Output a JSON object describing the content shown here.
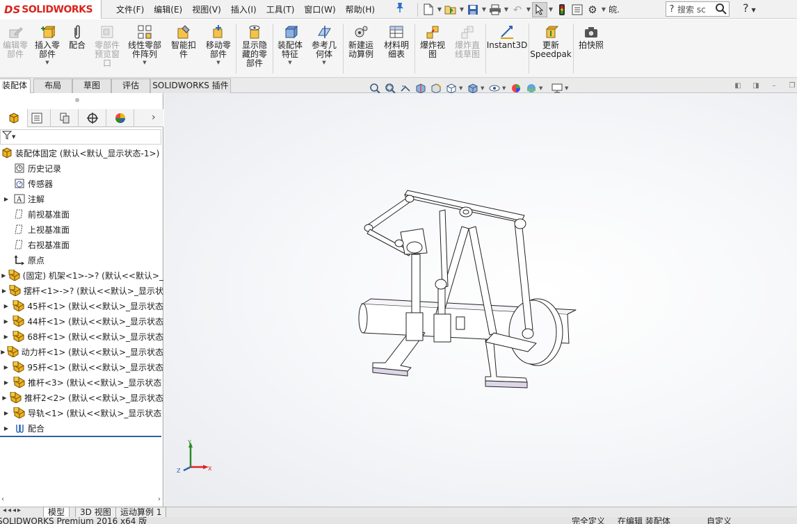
{
  "app": {
    "brand_ds": "DS",
    "brand": "SOLIDWORKS"
  },
  "menu": [
    "文件(F)",
    "编辑(E)",
    "视图(V)",
    "插入(I)",
    "工具(T)",
    "窗口(W)",
    "帮助(H)"
  ],
  "quick_toolbar": {
    "icons": [
      "new-document-icon",
      "open-icon",
      "save-icon",
      "print-icon",
      "undo-icon",
      "select-pointer-icon",
      "rebuild-icon",
      "file-properties-icon",
      "options-gear-icon"
    ],
    "overflow_label": "皖."
  },
  "search": {
    "placeholder": "搜索 sc"
  },
  "help": {
    "label": "?"
  },
  "ribbon": [
    {
      "label": "编辑零\n部件",
      "enabled": false,
      "icon": "edit-component-icon"
    },
    {
      "label": "插入零\n部件",
      "enabled": true,
      "icon": "insert-component-icon",
      "dropdown": true
    },
    {
      "label": "配合",
      "enabled": true,
      "icon": "mate-paperclip-icon"
    },
    {
      "label": "零部件\n预览窗\n口",
      "enabled": false,
      "icon": "component-preview-icon"
    },
    {
      "label": "线性零部\n件阵列",
      "enabled": true,
      "icon": "linear-pattern-icon",
      "dropdown": true
    },
    {
      "label": "智能扣\n件",
      "enabled": true,
      "icon": "smart-fasteners-icon"
    },
    {
      "label": "移动零\n部件",
      "enabled": true,
      "icon": "move-component-icon",
      "dropdown": true
    },
    {
      "label": "显示隐\n藏的零\n部件",
      "enabled": true,
      "icon": "show-hidden-icon"
    },
    {
      "label": "装配体\n特征",
      "enabled": true,
      "icon": "assembly-features-icon",
      "dropdown": true
    },
    {
      "label": "参考几\n何体",
      "enabled": true,
      "icon": "reference-geometry-icon",
      "dropdown": true
    },
    {
      "label": "新建运\n动算例",
      "enabled": true,
      "icon": "new-motion-study-icon"
    },
    {
      "label": "材料明\n细表",
      "enabled": true,
      "icon": "bill-of-materials-icon"
    },
    {
      "label": "爆炸视\n图",
      "enabled": true,
      "icon": "exploded-view-icon"
    },
    {
      "label": "爆炸直\n线草图",
      "enabled": false,
      "icon": "explode-line-sketch-icon"
    },
    {
      "label": "Instant3D",
      "enabled": true,
      "icon": "instant3d-icon"
    },
    {
      "label": "更新\nSpeedpak",
      "enabled": true,
      "icon": "update-speedpak-icon"
    },
    {
      "label": "拍快照",
      "enabled": true,
      "icon": "snapshot-camera-icon"
    }
  ],
  "tabs": [
    {
      "label": "装配体",
      "active": true
    },
    {
      "label": "布局",
      "active": false
    },
    {
      "label": "草图",
      "active": false
    },
    {
      "label": "评估",
      "active": false
    },
    {
      "label": "SOLIDWORKS 插件",
      "active": false
    }
  ],
  "heads_up_toolbar": [
    "zoom-to-fit-icon",
    "zoom-to-area-icon",
    "previous-view-icon",
    "section-view-icon",
    "dynamic-annotation-icon",
    "view-orientation-icon",
    "display-style-icon",
    "hide-show-items-icon",
    "edit-appearance-icon",
    "apply-scene-icon",
    "view-settings-icon"
  ],
  "panel_tabs": [
    "featuremanager-icon",
    "propertymanager-icon",
    "configurationmanager-icon",
    "dimxpert-icon",
    "display-manager-icon"
  ],
  "tree": {
    "root": "装配体固定 (默认<默认_显示状态-1>)",
    "items": [
      {
        "label": "历史记录",
        "icon": "history-icon",
        "expandable": false
      },
      {
        "label": "传感器",
        "icon": "sensor-icon",
        "expandable": false
      },
      {
        "label": "注解",
        "icon": "annotation-icon",
        "expandable": true
      },
      {
        "label": "前视基准面",
        "icon": "plane-icon",
        "expandable": false
      },
      {
        "label": "上视基准面",
        "icon": "plane-icon",
        "expandable": false
      },
      {
        "label": "右视基准面",
        "icon": "plane-icon",
        "expandable": false
      },
      {
        "label": "原点",
        "icon": "origin-icon",
        "expandable": false
      },
      {
        "label": "(固定) 机架<1>->? (默认<<默认>_",
        "icon": "part-icon",
        "expandable": true
      },
      {
        "label": "摆杆<1>->? (默认<<默认>_显示状",
        "icon": "part-icon",
        "expandable": true
      },
      {
        "label": "45杆<1> (默认<<默认>_显示状态",
        "icon": "part-icon",
        "expandable": true
      },
      {
        "label": "44杆<1> (默认<<默认>_显示状态",
        "icon": "part-icon",
        "expandable": true
      },
      {
        "label": "68杆<1> (默认<<默认>_显示状态",
        "icon": "part-icon",
        "expandable": true
      },
      {
        "label": "动力杆<1> (默认<<默认>_显示状态",
        "icon": "part-icon",
        "expandable": true
      },
      {
        "label": "95杆<1> (默认<<默认>_显示状态",
        "icon": "part-icon",
        "expandable": true
      },
      {
        "label": "推杆<3> (默认<<默认>_显示状态 ",
        "icon": "part-icon",
        "expandable": true
      },
      {
        "label": "推杆2<2> (默认<<默认>_显示状态",
        "icon": "part-icon",
        "expandable": true
      },
      {
        "label": "导轨<1> (默认<<默认>_显示状态 ",
        "icon": "part-icon",
        "expandable": true
      },
      {
        "label": "配合",
        "icon": "mates-icon",
        "expandable": true
      }
    ]
  },
  "triad": {
    "x": "X",
    "y": "Y",
    "z": "Z"
  },
  "bottom_tabs": [
    {
      "label": "模型",
      "active": true
    },
    {
      "label": "3D 视图",
      "active": false
    },
    {
      "label": "运动算例 1",
      "active": false
    }
  ],
  "status": {
    "left": "SOLIDWORKS Premium 2016 x64 版",
    "fully_defined": "完全定义",
    "editing": "在编辑 装配体",
    "custom": "自定义"
  },
  "colors": {
    "brand_red": "#d9251c",
    "accent_blue": "#2f5fa7",
    "part_yellow": "#f0b21e"
  }
}
